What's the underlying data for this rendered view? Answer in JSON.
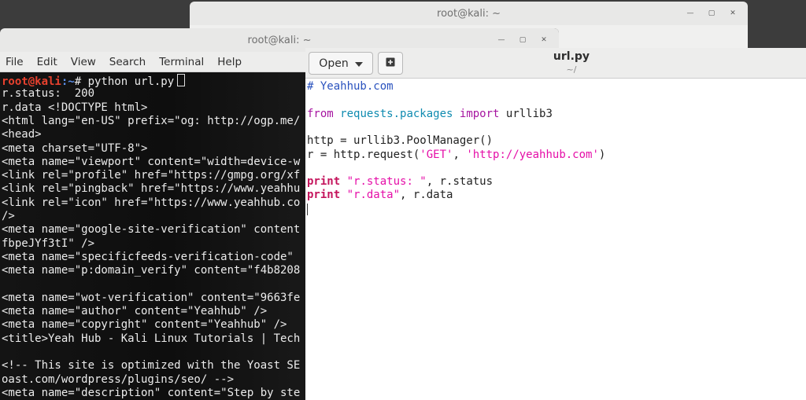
{
  "back_window": {
    "title": "root@kali: ~",
    "controls": [
      {
        "name": "minimize-icon",
        "glyph": "—"
      },
      {
        "name": "maximize-icon",
        "glyph": "▢"
      },
      {
        "name": "close-icon",
        "glyph": "✕"
      }
    ]
  },
  "terminal": {
    "title": "root@kali: ~",
    "controls": [
      {
        "name": "minimize-icon",
        "glyph": "—"
      },
      {
        "name": "maximize-icon",
        "glyph": "▢"
      },
      {
        "name": "close-icon",
        "glyph": "✕"
      }
    ],
    "menu": [
      "File",
      "Edit",
      "View",
      "Search",
      "Terminal",
      "Help"
    ],
    "prompt_user": "root@kali",
    "prompt_path": ":~",
    "prompt_symbol": "# ",
    "command": "python url.py",
    "output": [
      "r.status:  200",
      "r.data <!DOCTYPE html>",
      "<html lang=\"en-US\" prefix=\"og: http://ogp.me/",
      "<head>",
      "<meta charset=\"UTF-8\">",
      "<meta name=\"viewport\" content=\"width=device-w",
      "<link rel=\"profile\" href=\"https://gmpg.org/xf",
      "<link rel=\"pingback\" href=\"https://www.yeahhu",
      "<link rel=\"icon\" href=\"https://www.yeahhub.co",
      "/>",
      "<meta name=\"google-site-verification\" content",
      "fbpeJYf3tI\" />",
      "<meta name=\"specificfeeds-verification-code\"",
      "<meta name=\"p:domain_verify\" content=\"f4b8208",
      "",
      "<meta name=\"wot-verification\" content=\"9663fe",
      "<meta name=\"author\" content=\"Yeahhub\" />",
      "<meta name=\"copyright\" content=\"Yeahhub\" />",
      "<title>Yeah Hub - Kali Linux Tutorials | Tech",
      "",
      "<!-- This site is optimized with the Yoast SE",
      "oast.com/wordpress/plugins/seo/ -->",
      "<meta name=\"description\" content=\"Step by ste"
    ]
  },
  "gedit": {
    "open_label": "Open",
    "title": "url.py",
    "subtitle": "~/",
    "code": [
      [
        {
          "t": "# Yeahhub.com",
          "c": "c-comment"
        }
      ],
      [],
      [
        {
          "t": "from",
          "c": "c-kw"
        },
        {
          "t": " "
        },
        {
          "t": "requests.packages",
          "c": "c-mod"
        },
        {
          "t": " "
        },
        {
          "t": "import",
          "c": "c-kw"
        },
        {
          "t": " urllib3"
        }
      ],
      [],
      [
        {
          "t": "http = urllib3.PoolManager()"
        }
      ],
      [
        {
          "t": "r = http.request("
        },
        {
          "t": "'GET'",
          "c": "c-str"
        },
        {
          "t": ", "
        },
        {
          "t": "'http://yeahhub.com'",
          "c": "c-str"
        },
        {
          "t": ")"
        }
      ],
      [],
      [
        {
          "t": "print",
          "c": "c-print"
        },
        {
          "t": " "
        },
        {
          "t": "\"r.status: \"",
          "c": "c-str"
        },
        {
          "t": ", r.status"
        }
      ],
      [
        {
          "t": "print",
          "c": "c-print"
        },
        {
          "t": " "
        },
        {
          "t": "\"r.data\"",
          "c": "c-str"
        },
        {
          "t": ", r.data"
        }
      ]
    ]
  }
}
